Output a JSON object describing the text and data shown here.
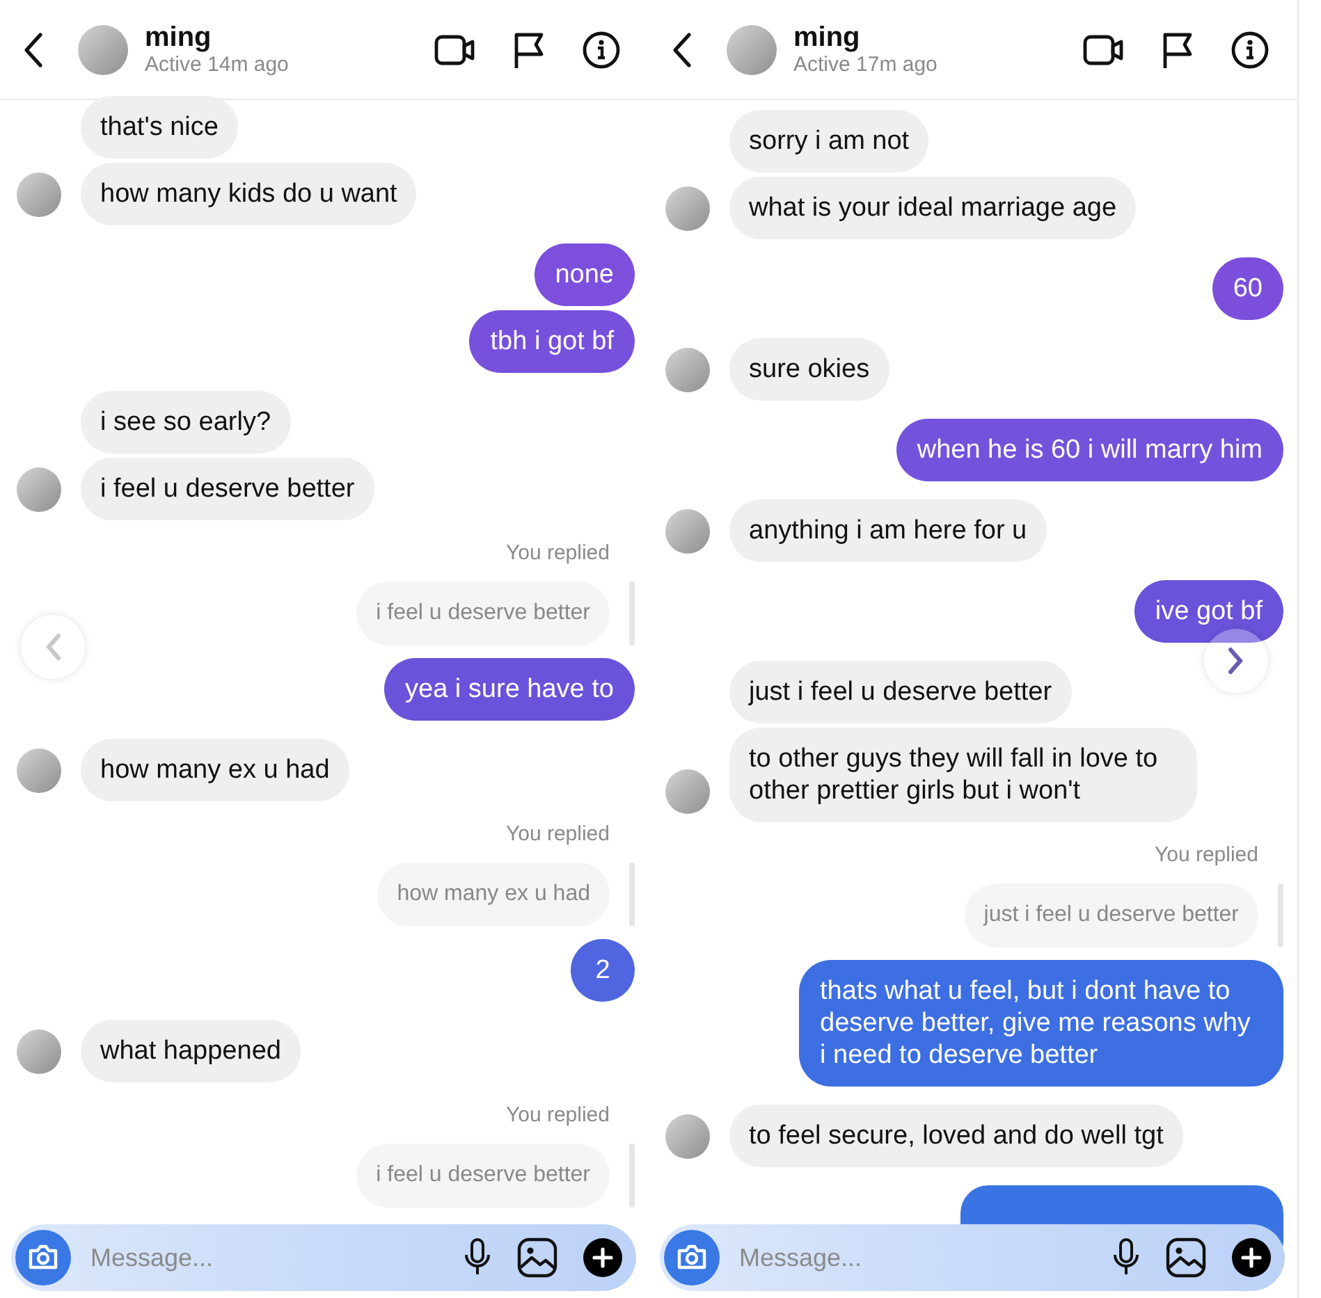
{
  "panels": [
    {
      "header": {
        "name": "ming",
        "status": "Active 14m ago"
      },
      "nav_arrow": {
        "kind": "prev"
      },
      "composer": {
        "placeholder": "Message..."
      },
      "messages": [
        {
          "kind": "received",
          "text": "that's nice",
          "avatar": false
        },
        {
          "kind": "received",
          "text": "how many kids do u want",
          "avatar": true
        },
        {
          "kind": "sent",
          "text": "none",
          "color": "#7c4fdc"
        },
        {
          "kind": "sent",
          "text": "tbh i got bf",
          "color": "#7750dc"
        },
        {
          "kind": "received",
          "text": "i see so early?",
          "avatar": false
        },
        {
          "kind": "received",
          "text": "i feel u deserve better",
          "avatar": true
        },
        {
          "kind": "reply_label",
          "text": "You replied"
        },
        {
          "kind": "quoted",
          "text": "i feel u deserve better"
        },
        {
          "kind": "sent",
          "text": "yea i sure have to",
          "color": "#6a52da"
        },
        {
          "kind": "received",
          "text": "how many ex u had",
          "avatar": true
        },
        {
          "kind": "reply_label",
          "text": "You replied"
        },
        {
          "kind": "quoted",
          "text": "how many ex u had"
        },
        {
          "kind": "sent",
          "text": "2",
          "color": "#4f66e0"
        },
        {
          "kind": "received",
          "text": "what happened",
          "avatar": true
        },
        {
          "kind": "reply_label",
          "text": "You replied"
        },
        {
          "kind": "quoted",
          "text": "i feel u deserve better"
        }
      ]
    },
    {
      "header": {
        "name": "ming",
        "status": "Active 17m ago"
      },
      "nav_arrow": {
        "kind": "next"
      },
      "composer": {
        "placeholder": "Message..."
      },
      "messages": [
        {
          "kind": "received",
          "text": "sorry i am not",
          "avatar": false
        },
        {
          "kind": "received",
          "text": "what is your ideal marriage age",
          "avatar": true
        },
        {
          "kind": "sent",
          "text": "60",
          "color": "#7b4fdc"
        },
        {
          "kind": "received",
          "text": "sure okies",
          "avatar": true
        },
        {
          "kind": "sent",
          "text": "when he is 60 i will marry him",
          "color": "#7352dc"
        },
        {
          "kind": "received",
          "text": "anything i am here for u",
          "avatar": true
        },
        {
          "kind": "sent",
          "text": "ive got bf",
          "color": "#6a52da"
        },
        {
          "kind": "received",
          "text": "just i feel u deserve better",
          "avatar": false
        },
        {
          "kind": "received",
          "text": "to other guys they will fall in love to other prettier girls but i won't",
          "avatar": true
        },
        {
          "kind": "reply_label",
          "text": "You replied"
        },
        {
          "kind": "quoted",
          "text": "just i feel u deserve better"
        },
        {
          "kind": "sent",
          "text": "thats what u feel, but i dont have to deserve better, give me reasons why i need to deserve better",
          "color": "#3d6fe2"
        },
        {
          "kind": "received",
          "text": "to feel secure, loved and do well tgt",
          "avatar": true
        },
        {
          "kind": "sent",
          "color": "#3a74e4"
        }
      ]
    }
  ]
}
